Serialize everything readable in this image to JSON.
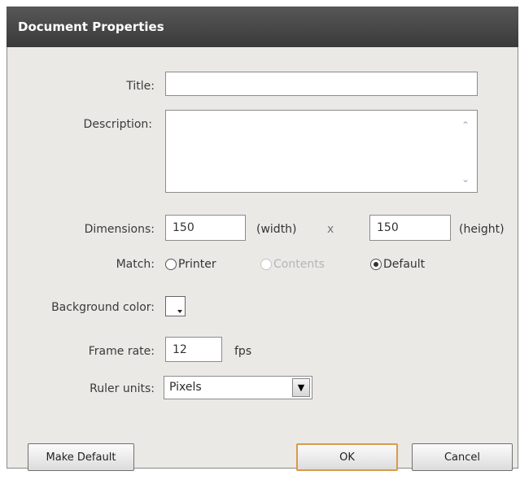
{
  "dialog": {
    "title": "Document Properties"
  },
  "labels": {
    "title": "Title:",
    "description": "Description:",
    "dimensions": "Dimensions:",
    "match": "Match:",
    "background_color": "Background color:",
    "frame_rate": "Frame rate:",
    "ruler_units": "Ruler units:"
  },
  "fields": {
    "title_value": "",
    "description_value": "",
    "width_value": "150",
    "height_value": "150",
    "frame_rate_value": "12",
    "ruler_units_value": "Pixels"
  },
  "captions": {
    "width": "(width)",
    "x": "x",
    "height": "(height)",
    "fps": "fps"
  },
  "match_options": [
    {
      "label": "Printer",
      "selected": false,
      "enabled": true
    },
    {
      "label": "Contents",
      "selected": false,
      "enabled": false
    },
    {
      "label": "Default",
      "selected": true,
      "enabled": true
    }
  ],
  "background_color": "#ffffff",
  "buttons": {
    "make_default": "Make Default",
    "ok": "OK",
    "cancel": "Cancel"
  },
  "icons": {
    "scroll_up": "chevron-up-icon",
    "scroll_down": "chevron-down-icon",
    "dropdown": "chevron-down-icon"
  }
}
